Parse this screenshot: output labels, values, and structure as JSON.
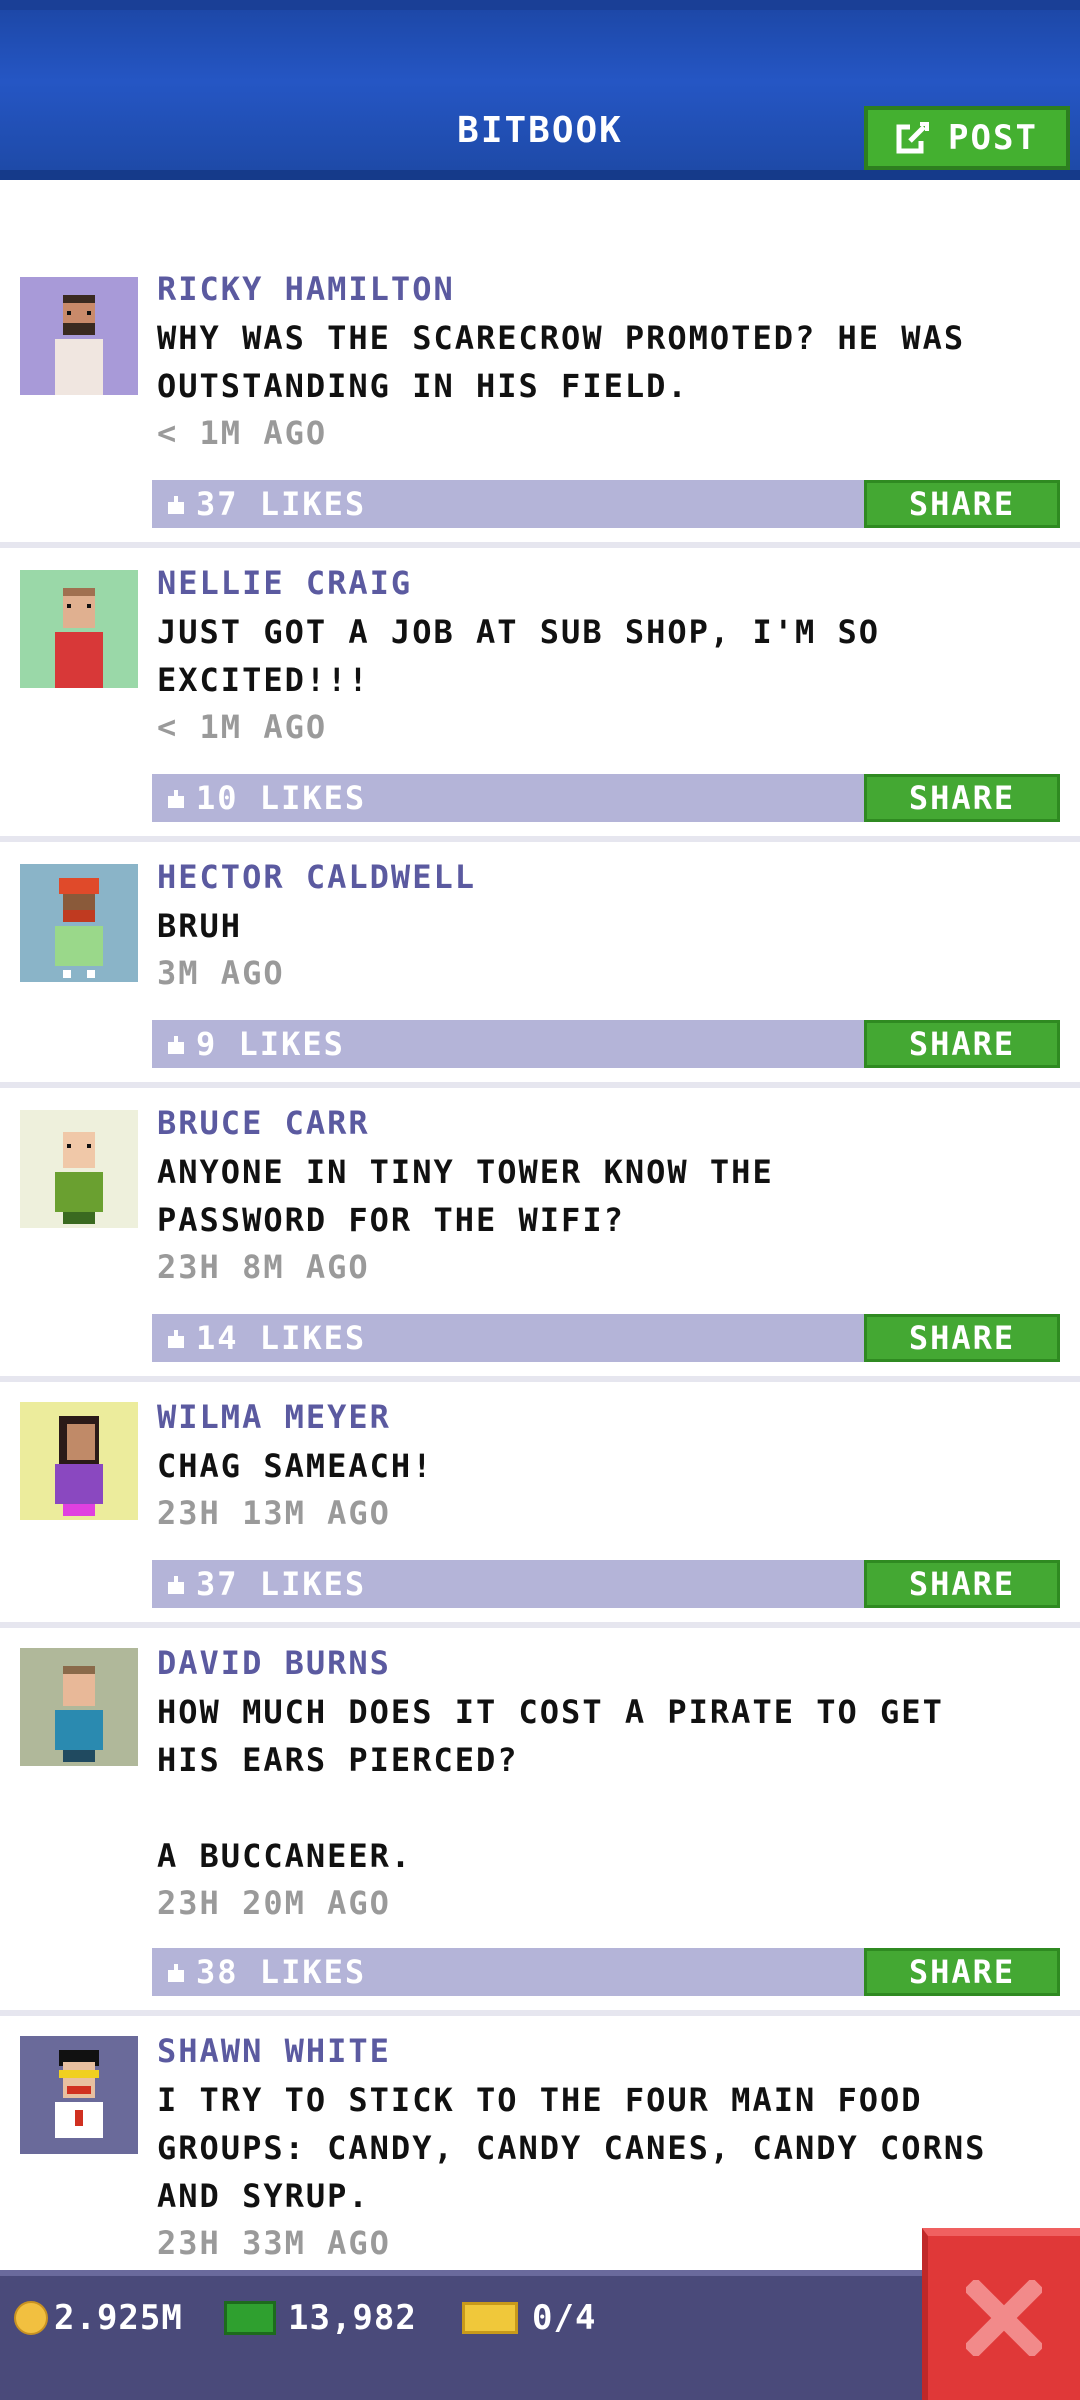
{
  "header": {
    "title": "BITBOOK",
    "post_label": "POST"
  },
  "share_label": "SHARE",
  "posts": [
    {
      "name": "RICKY HAMILTON",
      "text": "WHY WAS THE SCARECROW PROMOTED? HE WAS OUTSTANDING IN HIS FIELD.",
      "time": "< 1M AGO",
      "likes": "37 LIKES"
    },
    {
      "name": "NELLIE CRAIG",
      "text": "JUST GOT A JOB AT SUB SHOP, I'M SO EXCITED!!!",
      "time": "< 1M AGO",
      "likes": "10 LIKES"
    },
    {
      "name": "HECTOR CALDWELL",
      "text": "BRUH",
      "time": "3M AGO",
      "likes": "9 LIKES"
    },
    {
      "name": "BRUCE CARR",
      "text": "ANYONE IN TINY TOWER KNOW THE PASSWORD FOR THE WIFI?",
      "time": "23H 8M AGO",
      "likes": "14 LIKES"
    },
    {
      "name": "WILMA MEYER",
      "text": "CHAG SAMEACH!",
      "time": "23H 13M AGO",
      "likes": "37 LIKES"
    },
    {
      "name": "DAVID BURNS",
      "text": "HOW MUCH DOES IT COST A PIRATE TO GET HIS EARS PIERCED?\n\nA BUCCANEER.",
      "time": "23H 20M AGO",
      "likes": "38 LIKES"
    },
    {
      "name": "SHAWN WHITE",
      "text": "I TRY TO STICK TO THE FOUR MAIN FOOD GROUPS: CANDY, CANDY CANES, CANDY CORNS AND SYRUP.",
      "time": "23H 33M AGO",
      "likes": ""
    }
  ],
  "bottom_bar": {
    "coins": "2.925M",
    "bux": "13,982",
    "tickets": "0/4"
  },
  "colors": {
    "accent_green": "#44b030",
    "header_blue": "#2556c4",
    "likes_bar": "#b4b4d8",
    "close_red": "#e03838"
  }
}
